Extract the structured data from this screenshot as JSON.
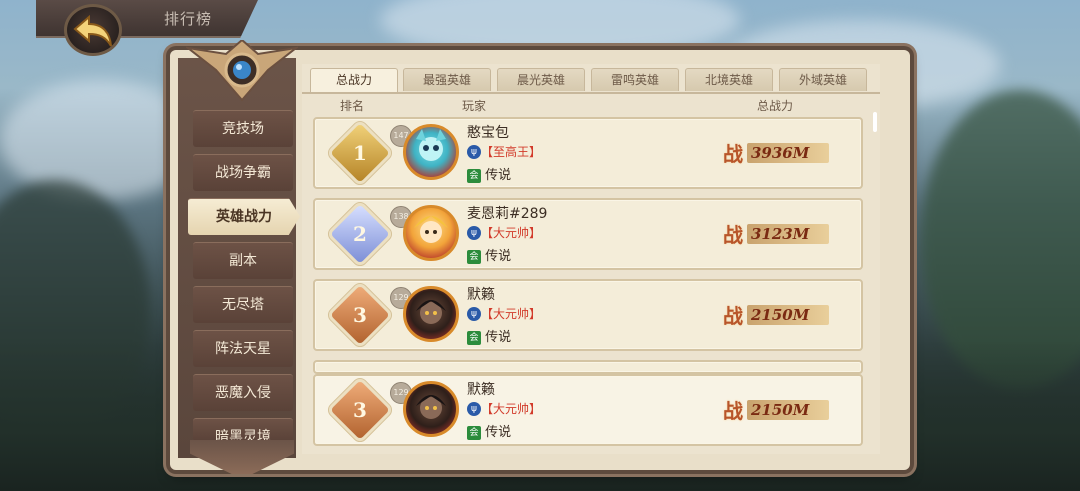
{
  "header": {
    "title": "排行榜"
  },
  "sidebar": {
    "items": [
      {
        "label": "竞技场",
        "active": false
      },
      {
        "label": "战场争霸",
        "active": false
      },
      {
        "label": "英雄战力",
        "active": true
      },
      {
        "label": "副本",
        "active": false
      },
      {
        "label": "无尽塔",
        "active": false
      },
      {
        "label": "阵法天星",
        "active": false
      },
      {
        "label": "恶魔入侵",
        "active": false
      },
      {
        "label": "暗黑灵境",
        "active": false
      }
    ]
  },
  "tabs": [
    {
      "label": "总战力",
      "active": true
    },
    {
      "label": "最强英雄",
      "active": false
    },
    {
      "label": "晨光英雄",
      "active": false
    },
    {
      "label": "雷鸣英雄",
      "active": false
    },
    {
      "label": "北境英雄",
      "active": false
    },
    {
      "label": "外域英雄",
      "active": false
    }
  ],
  "columns": {
    "rank": "排名",
    "player": "玩家",
    "power": "总战力"
  },
  "rows": [
    {
      "rank": "1",
      "level": "147",
      "name": "憨宝包",
      "title": "【至高王】",
      "guild_icon": "会",
      "guild": "传说",
      "power_icon": "战",
      "power": "3936M",
      "rank_color": "#d4a441"
    },
    {
      "rank": "2",
      "level": "138",
      "name": "麦恩莉#289",
      "title": "【大元帅】",
      "guild_icon": "会",
      "guild": "传说",
      "power_icon": "战",
      "power": "3123M",
      "rank_color": "#8e9ed8"
    },
    {
      "rank": "3",
      "level": "129",
      "name": "默籁",
      "title": "【大元帅】",
      "guild_icon": "会",
      "guild": "传说",
      "power_icon": "战",
      "power": "2150M",
      "rank_color": "#c97a48"
    }
  ],
  "self_row": {
    "rank": "3",
    "level": "129",
    "name": "默籁",
    "title": "【大元帅】",
    "guild_icon": "会",
    "guild": "传说",
    "power_icon": "战",
    "power": "2150M",
    "rank_color": "#c97a48"
  },
  "colors": {
    "accent_gold": "#d4a441",
    "title_red": "#d23a2a",
    "guild_green": "#2c8c3c",
    "frame_brown": "#5d4a3d"
  }
}
